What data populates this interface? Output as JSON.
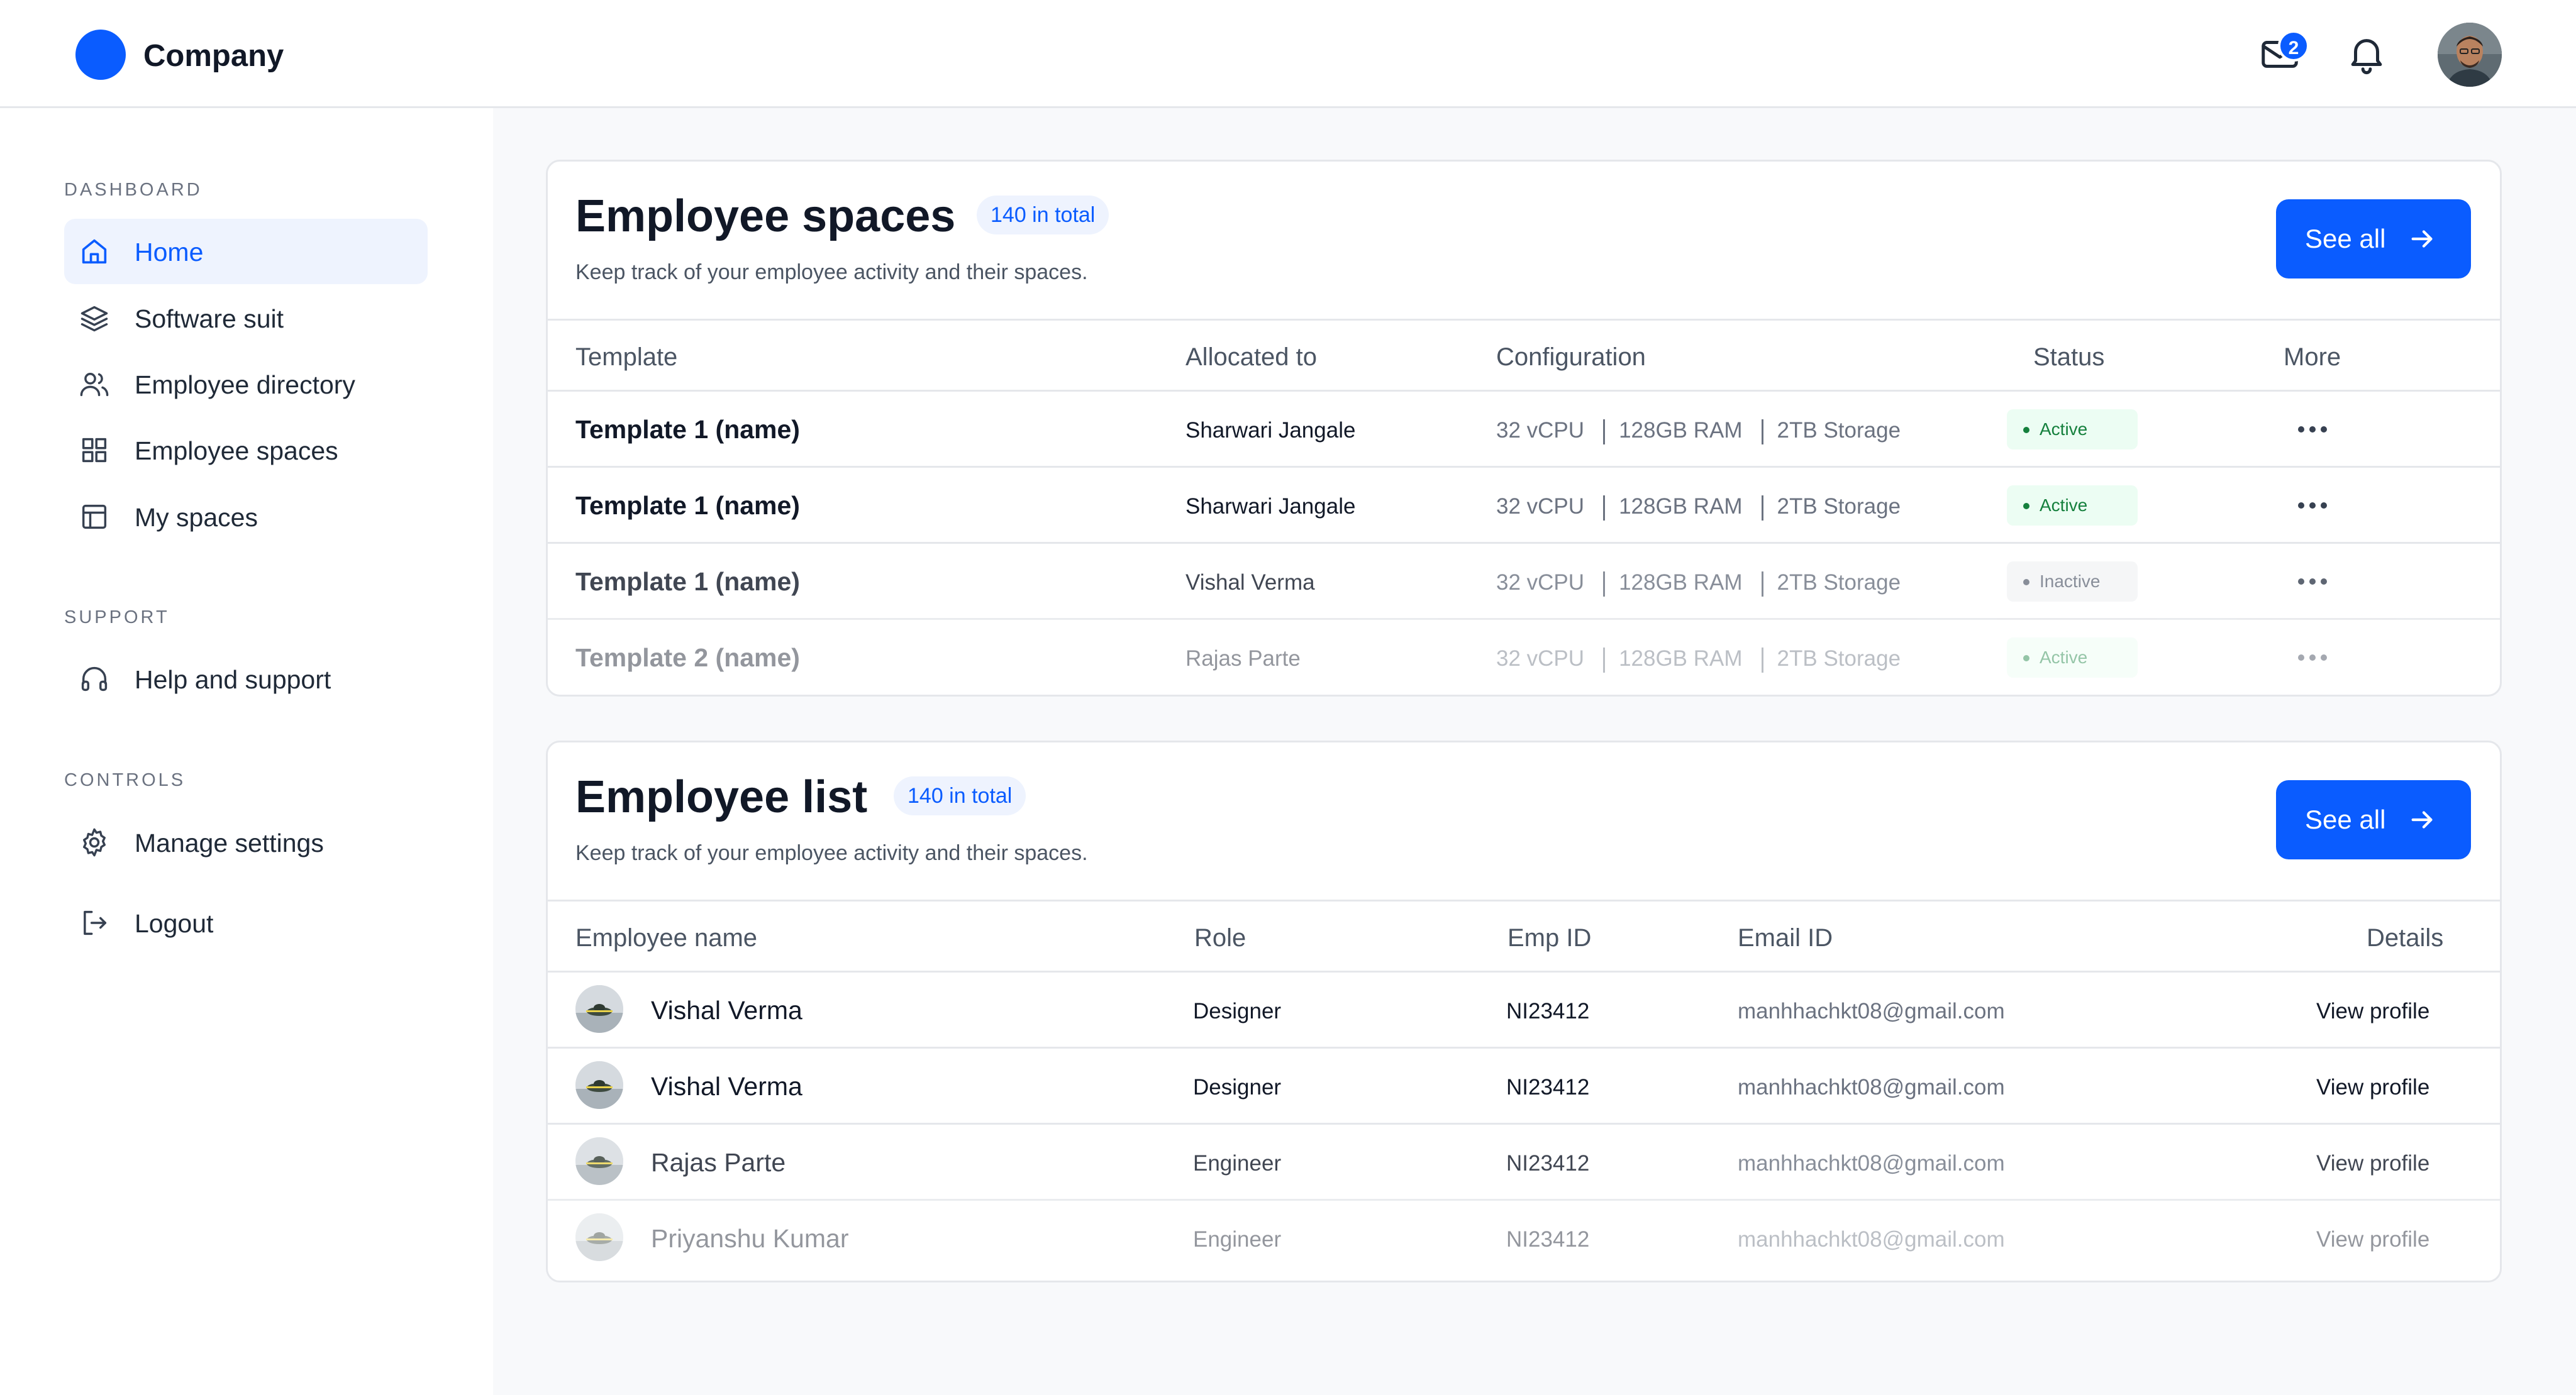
{
  "header": {
    "brand": "Company",
    "mail_badge_count": "2",
    "icons": [
      "mail-icon",
      "bell-icon"
    ]
  },
  "sidebar": {
    "sections": [
      {
        "label": "DASHBOARD",
        "items": [
          {
            "label": "Home",
            "icon": "home-icon",
            "active": true
          },
          {
            "label": "Software suit",
            "icon": "layers-icon"
          },
          {
            "label": "Employee directory",
            "icon": "users-icon"
          },
          {
            "label": "Employee spaces",
            "icon": "grid-icon"
          },
          {
            "label": "My spaces",
            "icon": "layout-icon"
          }
        ]
      },
      {
        "label": "SUPPORT",
        "items": [
          {
            "label": "Help and support",
            "icon": "headphones-icon"
          }
        ]
      },
      {
        "label": "CONTROLS",
        "items": [
          {
            "label": "Manage settings",
            "icon": "gear-icon"
          },
          {
            "label": "Logout",
            "icon": "logout-icon"
          }
        ]
      }
    ]
  },
  "spaces": {
    "title": "Employee spaces",
    "total": "140 in total",
    "subtitle": "Keep track of your employee activity and their spaces.",
    "see_all": "See all",
    "columns": [
      "Template",
      "Allocated to",
      "Configuration",
      "Status",
      "More"
    ],
    "rows": [
      {
        "template": "Template 1 (name)",
        "allocated": "Sharwari Jangale",
        "cpu": "32 vCPU",
        "ram": "128GB RAM",
        "storage": "2TB Storage",
        "status": "Active"
      },
      {
        "template": "Template 1 (name)",
        "allocated": "Sharwari Jangale",
        "cpu": "32 vCPU",
        "ram": "128GB RAM",
        "storage": "2TB Storage",
        "status": "Active"
      },
      {
        "template": "Template 1 (name)",
        "allocated": "Vishal Verma",
        "cpu": "32 vCPU",
        "ram": "128GB RAM",
        "storage": "2TB Storage",
        "status": "Inactive"
      },
      {
        "template": "Template 2 (name)",
        "allocated": "Rajas Parte",
        "cpu": "32 vCPU",
        "ram": "128GB RAM",
        "storage": "2TB Storage",
        "status": "Active"
      }
    ]
  },
  "employees": {
    "title": "Employee list",
    "total": "140 in total",
    "subtitle": "Keep track of your employee activity and their spaces.",
    "see_all": "See all",
    "columns": [
      "Employee name",
      "Role",
      "Emp ID",
      "Email ID",
      "Details"
    ],
    "rows": [
      {
        "name": "Vishal Verma",
        "role": "Designer",
        "emp_id": "NI23412",
        "email": "manhhachkt08@gmail.com",
        "details": "View profile"
      },
      {
        "name": "Vishal Verma",
        "role": "Designer",
        "emp_id": "NI23412",
        "email": "manhhachkt08@gmail.com",
        "details": "View profile"
      },
      {
        "name": "Rajas Parte",
        "role": "Engineer",
        "emp_id": "NI23412",
        "email": "manhhachkt08@gmail.com",
        "details": "View profile"
      },
      {
        "name": "Priyanshu Kumar",
        "role": "Engineer",
        "emp_id": "NI23412",
        "email": "manhhachkt08@gmail.com",
        "details": "View profile"
      }
    ]
  },
  "colors": {
    "accent": "#0a5cff",
    "active_bg": "#ecfdf3",
    "active_text": "#15803d",
    "inactive_bg": "#f3f4f6",
    "inactive_text": "#6b7280",
    "nav_active_bg": "#eef3fe"
  }
}
